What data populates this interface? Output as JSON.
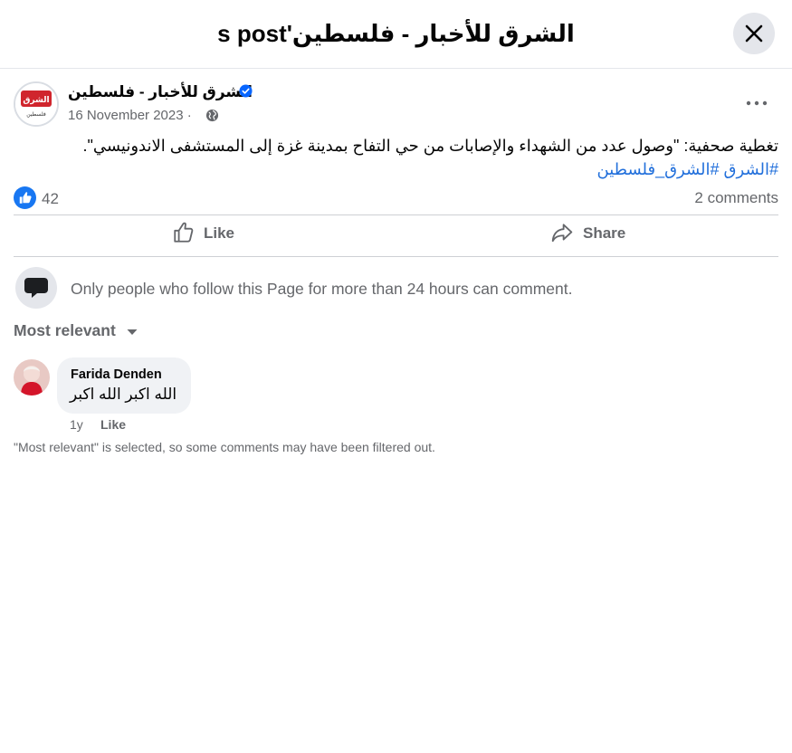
{
  "modal": {
    "title": "الشرق للأخبار - فلسطين's post",
    "close_icon": "close-icon"
  },
  "post": {
    "page_name": "الشرق للأخبار - فلسطين",
    "avatar_logo_text": "الشرق",
    "avatar_logo_subtext": "فلسطين",
    "date": "16 November 2023 ·",
    "text": "تغطية صحفية: \"وصول عدد  من الشهداء والإصابات من حي التفاح بمدينة غزة إلى المستشفى الاندونيسي\".",
    "hashtags": [
      "#الشرق",
      "#الشرق_فلسطين"
    ],
    "reaction_count": "42",
    "comments_count": "2 comments",
    "brand_color": "#0866ff"
  },
  "actions": {
    "like_label": "Like",
    "share_label": "Share"
  },
  "comment_notice": "Only people who follow this Page for more than 24 hours can comment.",
  "sort_label": "Most relevant",
  "comments": [
    {
      "author": "Farida Denden",
      "text": "الله اكبر الله اكبر",
      "age": "1y",
      "like_label": "Like"
    }
  ],
  "filter_note": "\"Most relevant\" is selected, so some comments may have been filtered out."
}
